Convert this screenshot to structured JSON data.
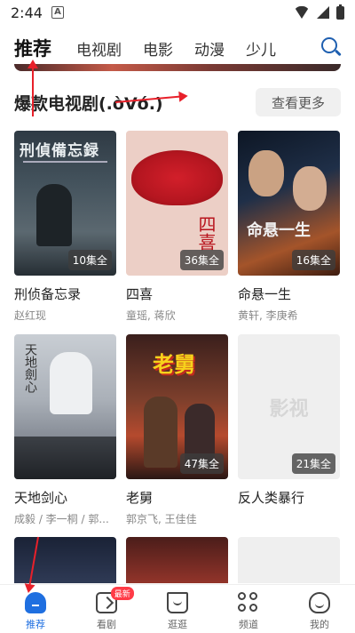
{
  "status_bar": {
    "time": "2:44",
    "notification_icon": "a-icon"
  },
  "top_nav": {
    "tabs": [
      {
        "label": "推荐",
        "active": true
      },
      {
        "label": "电视剧",
        "active": false
      },
      {
        "label": "电影",
        "active": false
      },
      {
        "label": "动漫",
        "active": false
      },
      {
        "label": "少儿",
        "active": false
      }
    ],
    "search_icon": "search-icon"
  },
  "section": {
    "title": "爆款电视剧(.òᐯó.)",
    "more_label": "查看更多"
  },
  "cards": [
    {
      "title": "刑侦备忘录",
      "cast": "赵红现",
      "episodes": "10集全",
      "poster_text": "刑偵備忘録"
    },
    {
      "title": "四喜",
      "cast": "童瑶, 蒋欣",
      "episodes": "36集全",
      "poster_text": "四喜"
    },
    {
      "title": "命悬一生",
      "cast": "黄轩, 李庚希",
      "episodes": "16集全",
      "poster_text": "命悬一生"
    },
    {
      "title": "天地剑心",
      "cast": "成毅 / 李一桐 / 郭...",
      "episodes": "",
      "poster_text": "天地劍心"
    },
    {
      "title": "老舅",
      "cast": "郭京飞, 王佳佳",
      "episodes": "47集全",
      "poster_text": "老舅"
    },
    {
      "title": "反人类暴行",
      "cast": "",
      "episodes": "21集全",
      "poster_text": "影视"
    }
  ],
  "bottom_nav": [
    {
      "label": "推荐",
      "icon": "home-icon",
      "active": true
    },
    {
      "label": "看剧",
      "icon": "watch-icon",
      "active": false,
      "badge": "最新"
    },
    {
      "label": "逛逛",
      "icon": "shop-icon",
      "active": false
    },
    {
      "label": "频道",
      "icon": "channel-icon",
      "active": false
    },
    {
      "label": "我的",
      "icon": "profile-icon",
      "active": false
    }
  ],
  "colors": {
    "accent": "#1f6fe0",
    "annotation_arrow": "#e8202a",
    "badge_red": "#ff3b47"
  }
}
